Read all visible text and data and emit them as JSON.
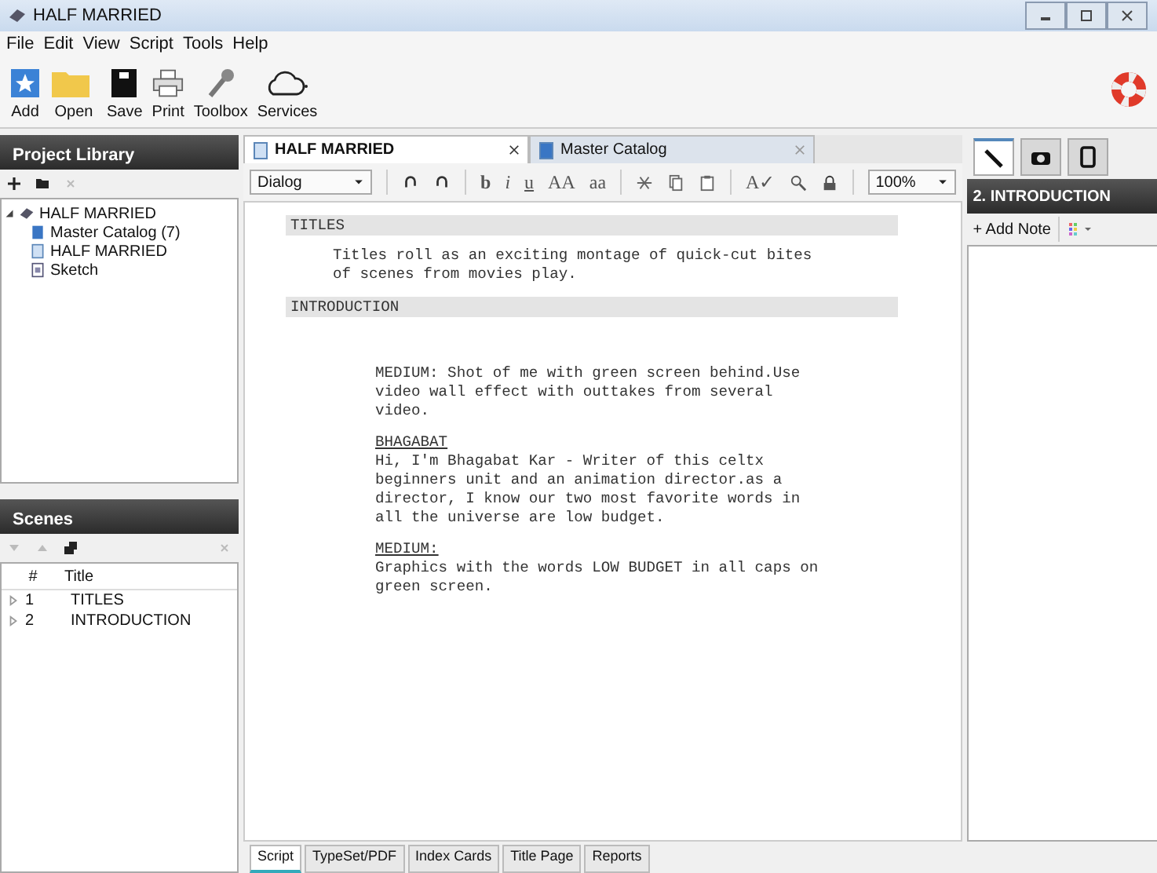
{
  "window": {
    "title": "HALF MARRIED"
  },
  "menu": [
    "File",
    "Edit",
    "View",
    "Script",
    "Tools",
    "Help"
  ],
  "toolbar": [
    {
      "kind": "add",
      "label": "Add"
    },
    {
      "kind": "open",
      "label": "Open"
    },
    {
      "kind": "save",
      "label": "Save"
    },
    {
      "kind": "print",
      "label": "Print"
    },
    {
      "kind": "toolbox",
      "label": "Toolbox"
    },
    {
      "kind": "services",
      "label": "Services"
    }
  ],
  "project_library": {
    "title": "Project Library",
    "tree": [
      {
        "label": "HALF MARRIED",
        "kind": "project",
        "expanded": true,
        "children": [
          {
            "label": "Master Catalog (7)",
            "kind": "catalog"
          },
          {
            "label": "HALF MARRIED",
            "kind": "script"
          },
          {
            "label": "Sketch",
            "kind": "sketch"
          }
        ]
      }
    ]
  },
  "scenes": {
    "title": "Scenes",
    "columns": [
      "#",
      "Title"
    ],
    "rows": [
      {
        "number": "1",
        "title": "TITLES"
      },
      {
        "number": "2",
        "title": "INTRODUCTION"
      }
    ]
  },
  "doc_tabs": [
    {
      "label": "HALF MARRIED",
      "selected": true
    },
    {
      "label": "Master Catalog",
      "selected": false
    }
  ],
  "format_toolbar": {
    "style": "Dialog",
    "text_buttons": [
      {
        "kind": "bold",
        "label": "b"
      },
      {
        "kind": "italic",
        "label": "i"
      },
      {
        "kind": "underline",
        "label": "u"
      },
      {
        "kind": "upper",
        "label": "AA"
      },
      {
        "kind": "lower",
        "label": "aa"
      }
    ],
    "spell": "A✓",
    "zoom": "100%"
  },
  "script": [
    {
      "kind": "scene",
      "text": "TITLES"
    },
    {
      "kind": "action",
      "text": "Titles roll as an exciting montage of quick-cut bites of scenes from movies play."
    },
    {
      "kind": "scene",
      "text": "INTRODUCTION"
    },
    {
      "kind": "shot",
      "text": "MEDIUM: Shot of me with green screen behind.Use video wall effect with outtakes from several video."
    },
    {
      "kind": "character",
      "text": "BHAGABAT"
    },
    {
      "kind": "dialogue",
      "text": "Hi, I'm Bhagabat Kar - Writer of this celtx beginners unit and an animation director.as a director, I know our two most favorite words in all the universe are low budget."
    },
    {
      "kind": "character",
      "text": "MEDIUM:"
    },
    {
      "kind": "dialogue",
      "text": "Graphics with the words LOW BUDGET in all caps on green screen."
    }
  ],
  "bottom_tabs": [
    {
      "label": "Script",
      "selected": true
    },
    {
      "label": "TypeSet/PDF",
      "selected": false
    },
    {
      "label": "Index Cards",
      "selected": false
    },
    {
      "label": "Title Page",
      "selected": false
    },
    {
      "label": "Reports",
      "selected": false
    }
  ],
  "notes": {
    "tabs": [
      {
        "kind": "pen",
        "selected": true
      },
      {
        "kind": "camera",
        "selected": false
      },
      {
        "kind": "device",
        "selected": false
      }
    ],
    "title": "2. INTRODUCTION",
    "add_note": "Add Note",
    "add_icon": "+"
  }
}
